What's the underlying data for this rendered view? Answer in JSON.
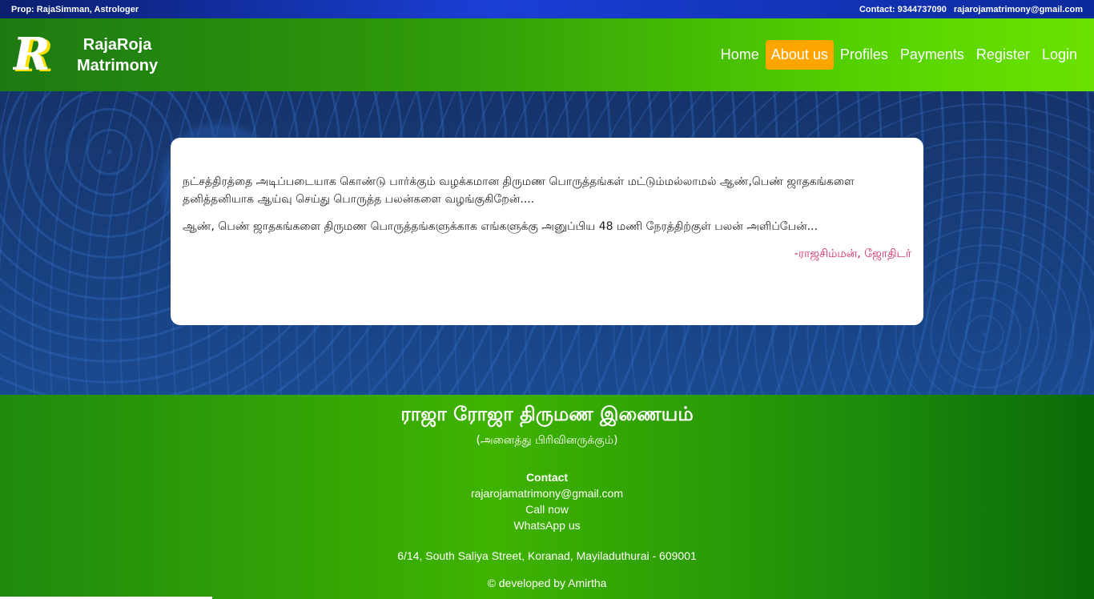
{
  "topbar": {
    "prop": "Prop: RajaSimman, Astrologer",
    "contact": "Contact: 9344737090",
    "email": "rajarojamatrimony@gmail.com"
  },
  "brand": {
    "logo_letter": "R",
    "line1": "RajaRoja",
    "line2": "Matrimony"
  },
  "nav": {
    "items": [
      "Home",
      "About us",
      "Profiles",
      "Payments",
      "Register",
      "Login"
    ],
    "active_index": 1
  },
  "about": {
    "para1": "நட்சத்திரத்தை அடிப்படையாக கொண்டு பார்க்கும் வழக்கமான திருமண பொருத்தங்கள் மட்டும்மல்லாமல் ஆண்,பெண் ஜாதகங்களை தனித்தனியாக ஆய்வு செய்து பொருத்த பலன்களை வழங்குகிறேன்....",
    "para2": "ஆண், பெண் ஜாதகங்களை திருமண பொருத்தங்களுக்காக எங்களுக்கு அனுப்பிய 48 மணி நேரத்திற்குள் பலன் அளிப்பேன்...",
    "signature": "-ராஜசிம்மன், ஜோதிடர்"
  },
  "footer": {
    "title": "ராஜா ரோஜா திருமண இணையம்",
    "subtitle": "(அனைத்து பிரிவினருக்கும்)",
    "contact_heading": "Contact",
    "email": "rajarojamatrimony@gmail.com",
    "call": "Call now",
    "whatsapp": "WhatsApp us",
    "address": "6/14, South Saliya Street, Koranad, Mayiladuthurai - 609001",
    "developed": "© developed by Amirtha"
  },
  "colors": {
    "accent": "#ffa500",
    "signature": "#d21f5f"
  }
}
